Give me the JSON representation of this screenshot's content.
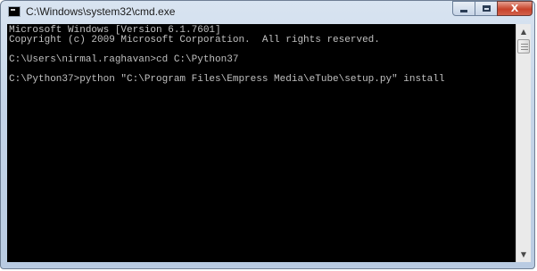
{
  "window": {
    "title": "C:\\Windows\\system32\\cmd.exe",
    "icons": {
      "app": "cmd-icon",
      "minimize": "minimize-icon",
      "maximize": "maximize-icon",
      "close": "close-icon"
    },
    "close_glyph": "X"
  },
  "console": {
    "lines": [
      "Microsoft Windows [Version 6.1.7601]",
      "Copyright (c) 2009 Microsoft Corporation.  All rights reserved.",
      "",
      "C:\\Users\\nirmal.raghavan>cd C:\\Python37",
      "",
      "C:\\Python37>python \"C:\\Program Files\\Empress Media\\eTube\\setup.py\" install"
    ],
    "colors": {
      "background": "#000000",
      "text": "#c0c0c0"
    }
  },
  "scrollbar": {
    "up_glyph": "▲",
    "down_glyph": "▼"
  }
}
